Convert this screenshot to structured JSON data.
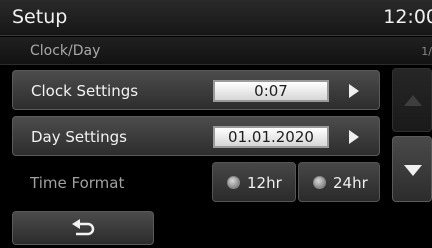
{
  "header": {
    "title": "Setup",
    "time": "12:00"
  },
  "subheader": {
    "title": "Clock/Day",
    "page_indicator": "1/"
  },
  "clock_settings": {
    "label": "Clock Settings",
    "value": "0:07"
  },
  "day_settings": {
    "label": "Day Settings",
    "value": "01.01.2020"
  },
  "time_format": {
    "label": "Time Format",
    "options": [
      {
        "label": "12hr"
      },
      {
        "label": "24hr"
      }
    ]
  },
  "icons": {
    "back": "back-arrow-icon",
    "row_arrow": "play-arrow-icon",
    "scroll_up": "triangle-up-icon",
    "scroll_down": "triangle-down-icon",
    "radio": "radio-dot-icon"
  },
  "colors": {
    "value_box": "#e8e8e8",
    "background": "#000000"
  }
}
